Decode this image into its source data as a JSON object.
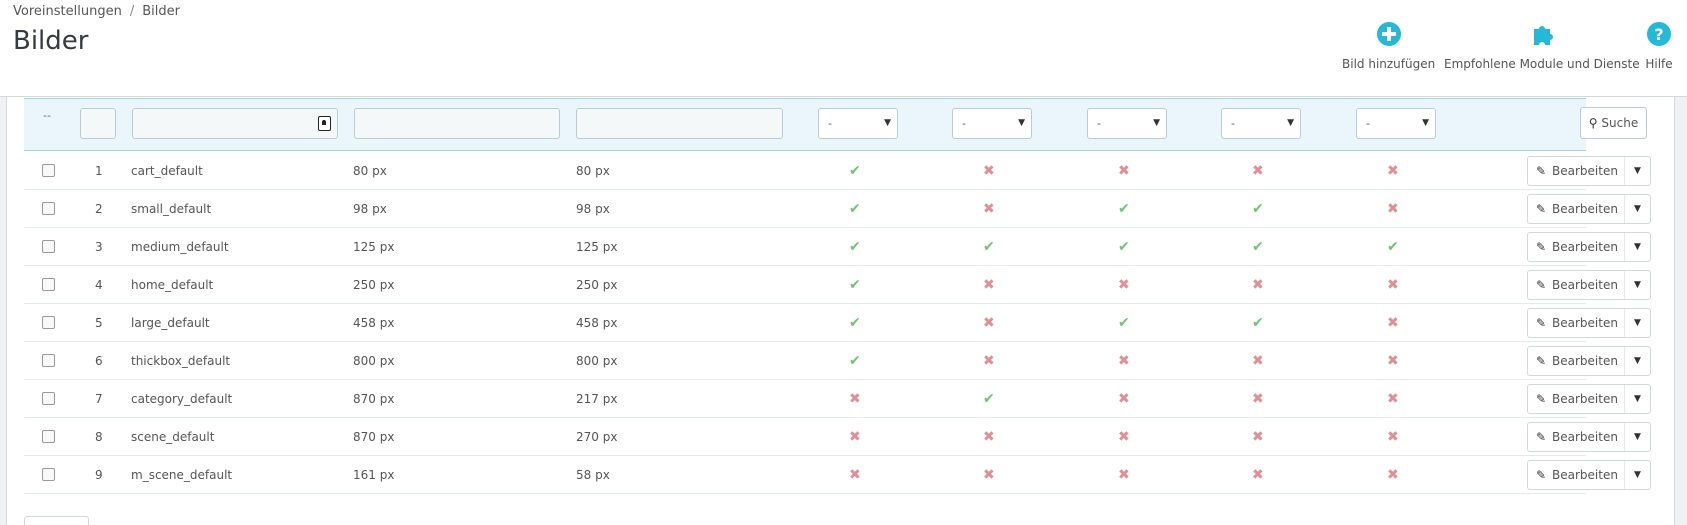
{
  "breadcrumb": {
    "parent": "Voreinstellungen",
    "separator": "/",
    "current": "Bilder"
  },
  "page_title": "Bilder",
  "toolbar": {
    "add": {
      "label": "Bild hinzufügen",
      "icon": "plus-circle-icon"
    },
    "modules": {
      "label": "Empfohlene Module und Dienste",
      "icon": "puzzle-icon"
    },
    "help": {
      "label": "Hilfe",
      "icon": "question-circle-icon"
    }
  },
  "filters": {
    "bulk_placeholder": "--",
    "select_default": "-",
    "search_label": "Suche"
  },
  "row_action_label": "Bearbeiten",
  "colors": {
    "accent": "#25b9d7",
    "ok": "#72c279",
    "no": "#e08f95"
  },
  "rows": [
    {
      "id": "1",
      "name": "cart_default",
      "width": "80 px",
      "height": "80 px",
      "flags": [
        true,
        false,
        false,
        false,
        false
      ]
    },
    {
      "id": "2",
      "name": "small_default",
      "width": "98 px",
      "height": "98 px",
      "flags": [
        true,
        false,
        true,
        true,
        false
      ]
    },
    {
      "id": "3",
      "name": "medium_default",
      "width": "125 px",
      "height": "125 px",
      "flags": [
        true,
        true,
        true,
        true,
        true
      ]
    },
    {
      "id": "4",
      "name": "home_default",
      "width": "250 px",
      "height": "250 px",
      "flags": [
        true,
        false,
        false,
        false,
        false
      ]
    },
    {
      "id": "5",
      "name": "large_default",
      "width": "458 px",
      "height": "458 px",
      "flags": [
        true,
        false,
        true,
        true,
        false
      ]
    },
    {
      "id": "6",
      "name": "thickbox_default",
      "width": "800 px",
      "height": "800 px",
      "flags": [
        true,
        false,
        false,
        false,
        false
      ]
    },
    {
      "id": "7",
      "name": "category_default",
      "width": "870 px",
      "height": "217 px",
      "flags": [
        false,
        true,
        false,
        false,
        false
      ]
    },
    {
      "id": "8",
      "name": "scene_default",
      "width": "870 px",
      "height": "270 px",
      "flags": [
        false,
        false,
        false,
        false,
        false
      ]
    },
    {
      "id": "9",
      "name": "m_scene_default",
      "width": "161 px",
      "height": "58 px",
      "flags": [
        false,
        false,
        false,
        false,
        false
      ]
    }
  ]
}
